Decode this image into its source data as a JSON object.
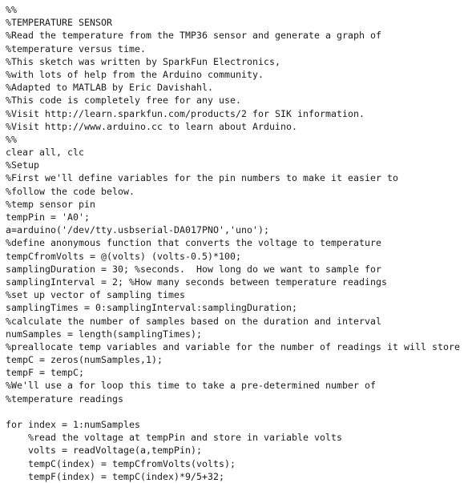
{
  "editor": {
    "language": "MATLAB",
    "background_color": "#ffffff",
    "text_color": "#1a1a1a",
    "font_size_px": 11.6,
    "line_height_px": 16.2,
    "indent_spaces": 4,
    "total_lines": 35
  },
  "code": {
    "lines": [
      "%%",
      "%TEMPERATURE SENSOR",
      "%Read the temperature from the TMP36 sensor and generate a graph of",
      "%temperature versus time.",
      "%This sketch was written by SparkFun Electronics,",
      "%with lots of help from the Arduino community.",
      "%Adapted to MATLAB by Eric Davishahl.",
      "%This code is completely free for any use.",
      "%Visit http://learn.sparkfun.com/products/2 for SIK information.",
      "%Visit http://www.arduino.cc to learn about Arduino.",
      "%%",
      "clear all, clc",
      "%Setup",
      "%First we'll define variables for the pin numbers to make it easier to",
      "%follow the code below.",
      "%temp sensor pin",
      "tempPin = 'A0';",
      "a=arduino('/dev/tty.usbserial-DA017PNO','uno');",
      "%define anonymous function that converts the voltage to temperature",
      "tempCfromVolts = @(volts) (volts-0.5)*100;",
      "samplingDuration = 30; %seconds.  How long do we want to sample for",
      "samplingInterval = 2; %How many seconds between temperature readings",
      "%set up vector of sampling times",
      "samplingTimes = 0:samplingInterval:samplingDuration;",
      "%calculate the number of samples based on the duration and interval",
      "numSamples = length(samplingTimes);",
      "%preallocate temp variables and variable for the number of readings it will store",
      "tempC = zeros(numSamples,1);",
      "tempF = tempC;",
      "%We'll use a for loop this time to take a pre-determined number of",
      "%temperature readings",
      "",
      "for index = 1:numSamples",
      "    %read the voltage at tempPin and store in variable volts",
      "    volts = readVoltage(a,tempPin);",
      "    tempC(index) = tempCfromVolts(volts);",
      "    tempF(index) = tempC(index)*9/5+32;"
    ]
  }
}
